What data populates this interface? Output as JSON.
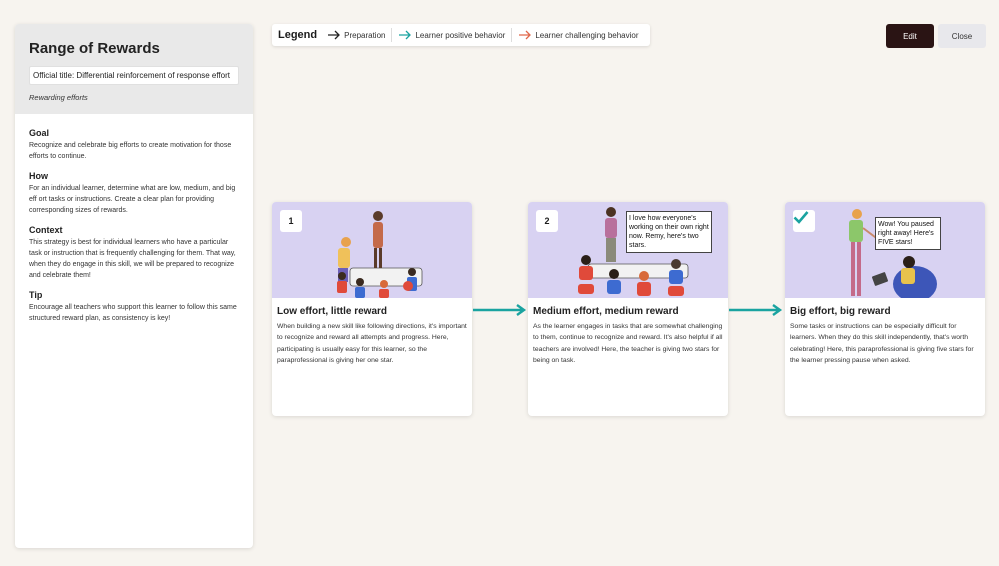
{
  "sidebar": {
    "title": "Range of Rewards",
    "official_title": "Official title: Differential reinforcement of response effort",
    "subtitle": "Rewarding efforts",
    "sections": [
      {
        "title": "Goal",
        "text": "Recognize and celebrate big efforts to create motivation for those efforts to continue."
      },
      {
        "title": "How",
        "text": "For an individual learner, determine what are low, medium, and big eff ort tasks or instructions. Create a clear plan for providing corresponding sizes of rewards."
      },
      {
        "title": "Context",
        "text": "This strategy is best for individual learners who have a particular task or instruction that is frequently challenging for them. That way, when they do engage in this skill, we will be prepared to recognize and celebrate them!"
      },
      {
        "title": "Tip",
        "text": "Encourage all teachers who support this learner to follow this same structured reward plan, as consistency is key!"
      }
    ]
  },
  "legend": {
    "title": "Legend",
    "items": [
      {
        "label": "Preparation",
        "color": "#222222"
      },
      {
        "label": "Learner positive behavior",
        "color": "#1aa3a0"
      },
      {
        "label": "Learner challenging behavior",
        "color": "#e0674a"
      }
    ]
  },
  "buttons": {
    "edit": "Edit",
    "close": "Close"
  },
  "colors": {
    "teal": "#1aa3a0",
    "illustration_bg": "#d8d2f2",
    "edit_bg": "#2a1414"
  },
  "cards": [
    {
      "step": "1",
      "title": "Low effort, little reward",
      "text": "When building a new skill like following directions, it's important to recognize and reward all attempts and progress. Here, participating is usually easy for this learner, so the paraprofessional is giving her one star."
    },
    {
      "step": "2",
      "speech": "I love how everyone's working on their own right now. Remy, here's two stars.",
      "title": "Medium effort, medium reward",
      "text": "As the learner engages in tasks that are somewhat challenging to them, continue to recognize and reward. It's also helpful if all teachers are involved! Here, the teacher is giving two stars for being on task."
    },
    {
      "step_icon": "checkmark-icon",
      "speech": "Wow! You paused right away! Here's FIVE stars!",
      "title": "Big effort, big reward",
      "text": "Some tasks or instructions can be especially difficult for learners. When they do this skill independently, that's worth celebrating! Here, this paraprofessional is giving five stars for the learner pressing pause when asked."
    }
  ]
}
